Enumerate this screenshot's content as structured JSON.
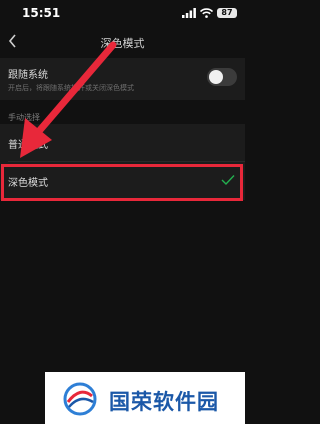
{
  "status_bar": {
    "time": "15:51",
    "battery": "87"
  },
  "nav": {
    "title": "深色模式"
  },
  "follow_system": {
    "label": "跟随系统",
    "description": "开启后，将跟随系统打开或关闭深色模式",
    "enabled": false
  },
  "manual_section": {
    "title": "手动选择",
    "options": [
      {
        "label": "普通模式",
        "selected": false
      },
      {
        "label": "深色模式",
        "selected": true
      }
    ]
  },
  "colors": {
    "annotation": "#e8283a",
    "check": "#23b04f",
    "watermark_text": "#1b58a8"
  },
  "watermark": {
    "text": "国荣软件园"
  }
}
